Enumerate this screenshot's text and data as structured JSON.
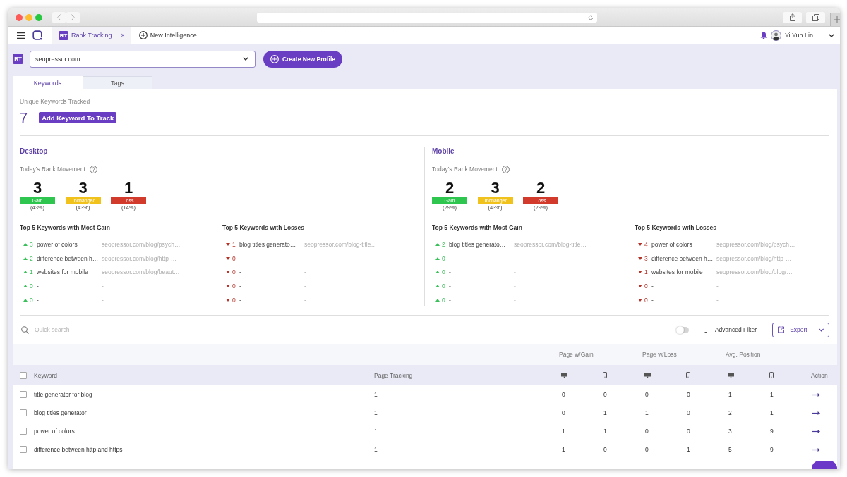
{
  "app_tabs": [
    {
      "badge": "RT",
      "label": "Rank Tracking",
      "close": "×",
      "selected": true
    },
    {
      "label": "New Intelligence",
      "selected": false
    }
  ],
  "user": {
    "name": "Yi Yun Lin"
  },
  "profile": {
    "badge": "RT",
    "select_value": "seopressor.com",
    "create_button": "Create New Profile"
  },
  "tabs": [
    {
      "label": "Keywords",
      "selected": true
    },
    {
      "label": "Tags",
      "selected": false
    }
  ],
  "summary": {
    "label": "Unique Keywords Tracked",
    "count": "7",
    "add_button": "Add Keyword To Track"
  },
  "devices": [
    {
      "title": "Desktop",
      "movement_label": "Today's Rank Movement",
      "stats": [
        {
          "kind": "gain",
          "value": "3",
          "label": "Gain",
          "percent": "(43%)"
        },
        {
          "kind": "unchanged",
          "value": "3",
          "label": "Unchanged",
          "percent": "(43%)"
        },
        {
          "kind": "loss",
          "value": "1",
          "label": "Loss",
          "percent": "(14%)"
        }
      ],
      "lists": [
        {
          "kind": "gain",
          "title": "Top 5 Keywords with Most Gain",
          "items": [
            {
              "change": "3",
              "keyword": "power of colors",
              "url": "seopressor.com/blog/psych…"
            },
            {
              "change": "2",
              "keyword": "difference between h…",
              "url": "seopressor.com/blog/http-…"
            },
            {
              "change": "1",
              "keyword": "websites for mobile",
              "url": "seopressor.com/blog/beaut…"
            },
            {
              "change": "0",
              "keyword": "-",
              "url": "-"
            },
            {
              "change": "0",
              "keyword": "-",
              "url": "-"
            }
          ]
        },
        {
          "kind": "loss",
          "title": "Top 5 Keywords with Losses",
          "items": [
            {
              "change": "1",
              "keyword": "blog titles generato…",
              "url": "seopressor.com/blog-title…"
            },
            {
              "change": "0",
              "keyword": "-",
              "url": "-"
            },
            {
              "change": "0",
              "keyword": "-",
              "url": "-"
            },
            {
              "change": "0",
              "keyword": "-",
              "url": "-"
            },
            {
              "change": "0",
              "keyword": "-",
              "url": "-"
            }
          ]
        }
      ]
    },
    {
      "title": "Mobile",
      "movement_label": "Today's Rank Movement",
      "stats": [
        {
          "kind": "gain",
          "value": "2",
          "label": "Gain",
          "percent": "(29%)"
        },
        {
          "kind": "unchanged",
          "value": "3",
          "label": "Unchanged",
          "percent": "(43%)"
        },
        {
          "kind": "loss",
          "value": "2",
          "label": "Loss",
          "percent": "(29%)"
        }
      ],
      "lists": [
        {
          "kind": "gain",
          "title": "Top 5 Keywords with Most Gain",
          "items": [
            {
              "change": "2",
              "keyword": "blog titles generato…",
              "url": "seopressor.com/blog-title…"
            },
            {
              "change": "0",
              "keyword": "-",
              "url": "-"
            },
            {
              "change": "0",
              "keyword": "-",
              "url": "-"
            },
            {
              "change": "0",
              "keyword": "-",
              "url": "-"
            },
            {
              "change": "0",
              "keyword": "-",
              "url": "-"
            }
          ]
        },
        {
          "kind": "loss",
          "title": "Top 5 Keywords with Losses",
          "items": [
            {
              "change": "4",
              "keyword": "power of colors",
              "url": "seopressor.com/blog/psych…"
            },
            {
              "change": "3",
              "keyword": "difference between h…",
              "url": "seopressor.com/blog/http-…"
            },
            {
              "change": "1",
              "keyword": "websites for mobile",
              "url": "seopressor.com/blog/blog/…"
            },
            {
              "change": "0",
              "keyword": "-",
              "url": "-"
            },
            {
              "change": "0",
              "keyword": "-",
              "url": "-"
            }
          ]
        }
      ]
    }
  ],
  "table_toolbar": {
    "search_placeholder": "Quick search",
    "toggle": {
      "on": false
    },
    "filter_button": "Advanced Filter",
    "export_button": "Export"
  },
  "table": {
    "column_groups": [
      {
        "label": "Page w/Gain"
      },
      {
        "label": "Page w/Loss"
      },
      {
        "label": "Avg. Position"
      }
    ],
    "columns": [
      {
        "kind": "check",
        "checked": false
      },
      {
        "kind": "label",
        "label": "Keyword"
      },
      {
        "kind": "label",
        "label": "Page Tracking"
      },
      {
        "kind": "desktop"
      },
      {
        "kind": "mobile"
      },
      {
        "kind": "desktop"
      },
      {
        "kind": "mobile"
      },
      {
        "kind": "desktop"
      },
      {
        "kind": "mobile"
      },
      {
        "kind": "label",
        "label": "Action"
      }
    ],
    "rows": [
      {
        "checked": false,
        "keyword": "title generator for blog",
        "page_tracking": "1",
        "values": [
          "0",
          "0",
          "0",
          "0",
          "1",
          "1"
        ]
      },
      {
        "checked": false,
        "keyword": "blog titles generator",
        "page_tracking": "1",
        "values": [
          "0",
          "1",
          "1",
          "0",
          "2",
          "1"
        ]
      },
      {
        "checked": false,
        "keyword": "power of colors",
        "page_tracking": "1",
        "values": [
          "1",
          "1",
          "0",
          "0",
          "3",
          "9"
        ]
      },
      {
        "checked": false,
        "keyword": "difference between http and https",
        "page_tracking": "1",
        "values": [
          "1",
          "0",
          "0",
          "1",
          "5",
          "9"
        ]
      }
    ]
  }
}
